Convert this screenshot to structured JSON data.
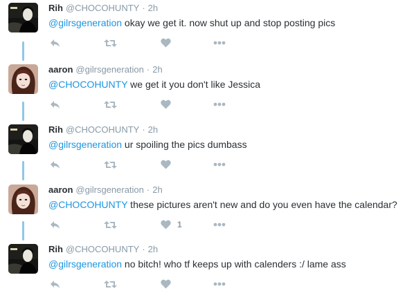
{
  "colors": {
    "mention": "#1b95e0",
    "meta": "#8899a6",
    "thread_line": "#8ec7e6",
    "icon": "#aab8c2"
  },
  "tweets": [
    {
      "name": "Rih",
      "handle": "@CHOCOHUNTY",
      "dot": "·",
      "time": "2h",
      "mention": "@gilrsgeneration",
      "text": " okay we get it. now shut up and stop posting pics",
      "likes": ""
    },
    {
      "name": "aaron",
      "handle": "@gilrsgeneration",
      "dot": "·",
      "time": "2h",
      "mention": "@CHOCOHUNTY",
      "text": " we get it you don't like Jessica",
      "likes": ""
    },
    {
      "name": "Rih",
      "handle": "@CHOCOHUNTY",
      "dot": "·",
      "time": "2h",
      "mention": "@gilrsgeneration",
      "text": " ur spoiling the pics dumbass",
      "likes": ""
    },
    {
      "name": "aaron",
      "handle": "@gilrsgeneration",
      "dot": "·",
      "time": "2h",
      "mention": "@CHOCOHUNTY",
      "text": " these pictures aren't new and do you even have the calendar?",
      "likes": "1"
    },
    {
      "name": "Rih",
      "handle": "@CHOCOHUNTY",
      "dot": "·",
      "time": "2h",
      "mention": "@gilrsgeneration",
      "text": " no bitch! who tf keeps up with calenders :/ lame ass",
      "likes": ""
    }
  ]
}
